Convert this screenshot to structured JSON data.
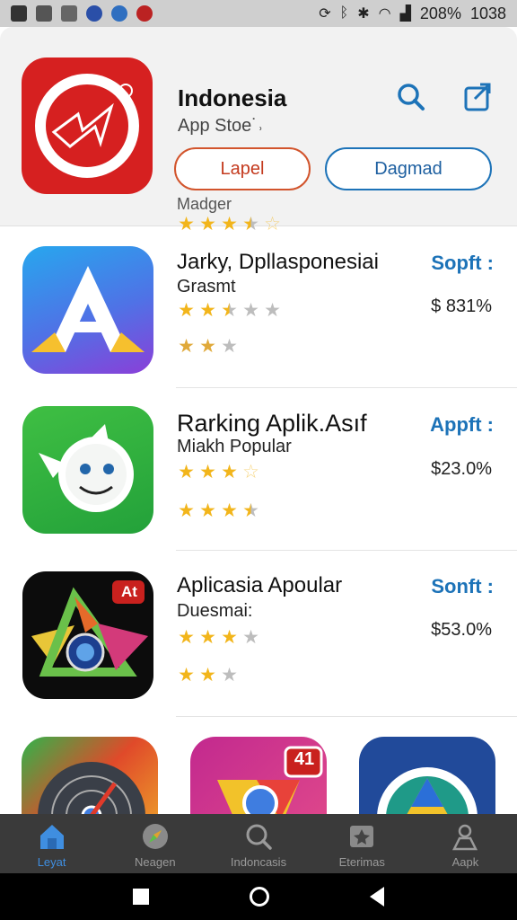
{
  "status_bar": {
    "battery": "208%",
    "time": "1038"
  },
  "header": {
    "title": "Indonesia",
    "subtitle": "App Stoe˙˒",
    "lapel_button": "Lapel",
    "download_button": "Dagmad",
    "maker": "Madger",
    "rating": [
      1,
      1,
      1,
      0.5,
      0
    ]
  },
  "items": [
    {
      "name": "Jarky, Dpllasponesiai",
      "category": "Grasmt",
      "action": "Sopft :",
      "price": "$ 831%",
      "stars1": [
        1,
        1,
        0.5,
        0,
        0
      ],
      "stars2": [
        1,
        1,
        0,
        0,
        0
      ]
    },
    {
      "name": "Rarking Aplik.Asıf",
      "category": "Miakh Popular",
      "action": "Appft :",
      "price": "$23.0%",
      "stars1": [
        1,
        1,
        1,
        0,
        0
      ],
      "stars2": [
        1,
        1,
        1,
        0.5,
        0
      ]
    },
    {
      "name": "Aplicasia Apoular",
      "category": "Duesmai:",
      "action": "Sonft :",
      "price": "$53.0%",
      "stars1": [
        1,
        1,
        1,
        0,
        0
      ],
      "stars2": [
        1,
        1,
        0,
        0,
        0
      ]
    }
  ],
  "tile_badge": "41",
  "app3_badge": "At",
  "tabs": [
    {
      "label": "Leyat",
      "icon": "home-icon",
      "active": true
    },
    {
      "label": "Neagen",
      "icon": "compass-icon",
      "active": false
    },
    {
      "label": "Indoncasis",
      "icon": "search-icon",
      "active": false
    },
    {
      "label": "Eterimas",
      "icon": "apps-icon",
      "active": false
    },
    {
      "label": "Aapk",
      "icon": "profile-icon",
      "active": false
    }
  ],
  "colors": {
    "accent_blue": "#1d73b8",
    "accent_red": "#d2542c",
    "star_gold": "#f2b51b",
    "tab_bg": "#3a3a3a"
  }
}
